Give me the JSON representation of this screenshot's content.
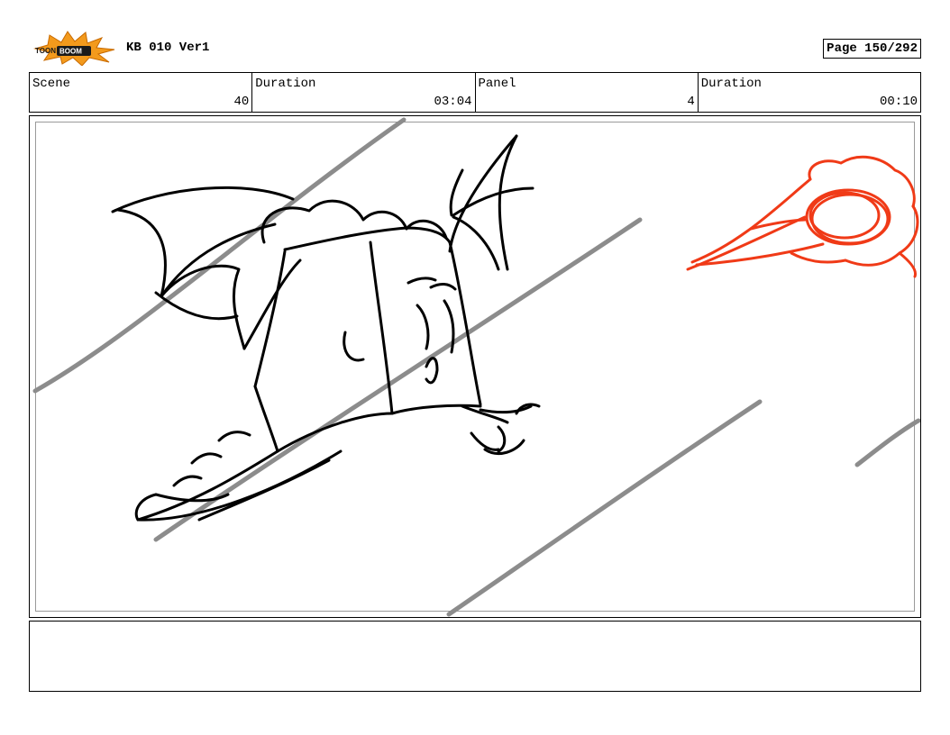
{
  "header": {
    "logo_text_left": "TOON",
    "logo_text_right": "BOOM",
    "document_title": "KB 010 Ver1",
    "page_label": "Page 150/292"
  },
  "info": {
    "scene_label": "Scene",
    "scene_value": "40",
    "scene_duration_label": "Duration",
    "scene_duration_value": "03:04",
    "panel_label": "Panel",
    "panel_value": "4",
    "panel_duration_label": "Duration",
    "panel_duration_value": "00:10"
  },
  "notes": {
    "text": ""
  },
  "colors": {
    "sketch": "#000000",
    "speed_lines": "#8c8c8c",
    "fireball": "#f03a17",
    "logo_burst": "#f39a1c"
  }
}
